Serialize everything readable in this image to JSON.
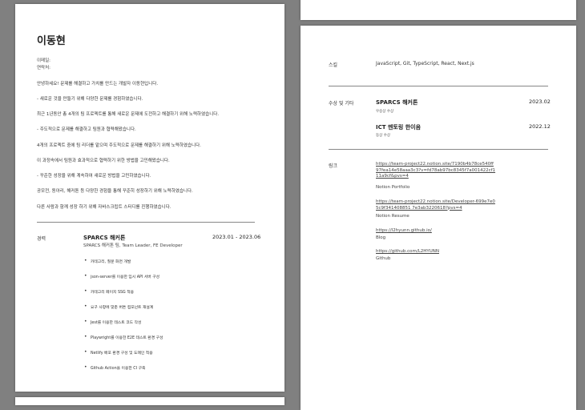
{
  "profile": {
    "name": "이동현",
    "email_label": "이메일:",
    "phone_label": "연락처:"
  },
  "intro": [
    "안녕하세요! 문제를 해결하고 가치를 만드는 개발자 이동현입니다.",
    "- 새로운 것을 만들기 위해 다양한 문제를 경험하였습니다.",
    "최근 1년동안 총 4개의 팀 프로젝트를 통해 새로운 문제에 도전하고 해결하기 위해 노력하였습니다.",
    "- 주도적으로 문제를 해결하고 팀원과 협력해왔습니다.",
    "4개의 프로젝트 중에 팀 리더를 맡으며 주도적으로 문제를 해결하기 위해 노력하였습니다.",
    "이 과정속에서 팀원과 효과적으로 협력하기 위한 방법을 고민해왔습니다.",
    "- 꾸준한 성장을 위해 계속하여 새로운 방법을 고민하였습니다.",
    "공모전, 동아리, 해커톤 등 다양한 경험을 통해 꾸준히 성장하기 위해 노력하였습니다.",
    "다른 사람과 함께 성장 하기 위해 자바스크립트 스터디를 진행하였습니다."
  ],
  "career": {
    "label": "경력",
    "title": "SPARCS 해커톤",
    "subtitle": "SPARCS 해커톤 팀, Team Leader, FE Developer",
    "period": "2023.01 - 2023.06",
    "bullets": [
      "카테고리, 질문 화면 개발",
      "json-server를 이용한 임시 API 서버 구성",
      "카테고리 페이지 SSG 적용",
      "요구 사항에 맞춘 버튼 컴포넌트 재설계",
      "Jest를 이용한 테스트 코드 작성",
      "Playwright를 이용한 E2E 테스트 환경 구성",
      "Netlify 배포 환경 구성 및 도메인 적용",
      "Github Action을 이용한 CI 구축"
    ]
  },
  "skills": {
    "label": "스킬",
    "value": "JavaScript, Git, TypeScript, React, Next.js"
  },
  "awards": {
    "label": "수상 및 기타",
    "items": [
      {
        "title": "SPARCS 해커톤",
        "sub": "우승상 수상",
        "date": "2023.02"
      },
      {
        "title": "ICT 멘토링 한이음",
        "sub": "동상 수상",
        "date": "2022.12"
      }
    ]
  },
  "links": {
    "label": "링크",
    "items": [
      {
        "url": "https://team-project22.notion.site/7190b4b78ce540ff97fea14e58aaa3c3?v=fd78ab97bc8345f7a001422cf111a9cf&pvs=4",
        "desc": "Notion Portfolio"
      },
      {
        "url": "https://team-project22.notion.site/Developer-699e7e05c9f341408851 7e3ab3220618?pvs=4",
        "desc": "Notion Resume"
      },
      {
        "url": "https://l2hyunn.github.io/",
        "desc": "Blog"
      },
      {
        "url": "https://github.com/L2HYUNN",
        "desc": "Github"
      }
    ]
  }
}
